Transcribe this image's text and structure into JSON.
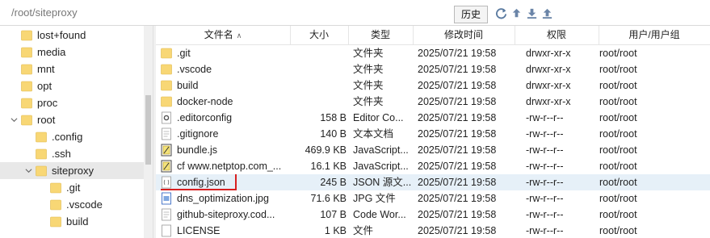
{
  "pathbar": {
    "path": "/root/siteproxy",
    "history_label": "历史",
    "icons": [
      "refresh-icon",
      "up-arrow-icon",
      "download-icon",
      "upload-icon"
    ]
  },
  "tree": {
    "items": [
      {
        "label": "lost+found",
        "indent": 0,
        "expander": ""
      },
      {
        "label": "media",
        "indent": 0,
        "expander": ""
      },
      {
        "label": "mnt",
        "indent": 0,
        "expander": ""
      },
      {
        "label": "opt",
        "indent": 0,
        "expander": ""
      },
      {
        "label": "proc",
        "indent": 0,
        "expander": ""
      },
      {
        "label": "root",
        "indent": 0,
        "expander": "expanded"
      },
      {
        "label": ".config",
        "indent": 1,
        "expander": ""
      },
      {
        "label": ".ssh",
        "indent": 1,
        "expander": ""
      },
      {
        "label": "siteproxy",
        "indent": 1,
        "expander": "expanded",
        "selected": true
      },
      {
        "label": ".git",
        "indent": 2,
        "expander": ""
      },
      {
        "label": ".vscode",
        "indent": 2,
        "expander": ""
      },
      {
        "label": "build",
        "indent": 2,
        "expander": ""
      }
    ]
  },
  "list": {
    "columns": {
      "name": "文件名",
      "size": "大小",
      "type": "类型",
      "date": "修改时间",
      "perm": "权限",
      "owner": "用户/用户组"
    },
    "rows": [
      {
        "name": ".git",
        "size": "",
        "type": "文件夹",
        "date": "2025/07/21 19:58",
        "perm": "drwxr-xr-x",
        "owner": "root/root",
        "icon": "folder-icon"
      },
      {
        "name": ".vscode",
        "size": "",
        "type": "文件夹",
        "date": "2025/07/21 19:58",
        "perm": "drwxr-xr-x",
        "owner": "root/root",
        "icon": "folder-icon"
      },
      {
        "name": "build",
        "size": "",
        "type": "文件夹",
        "date": "2025/07/21 19:58",
        "perm": "drwxr-xr-x",
        "owner": "root/root",
        "icon": "folder-icon"
      },
      {
        "name": "docker-node",
        "size": "",
        "type": "文件夹",
        "date": "2025/07/21 19:58",
        "perm": "drwxr-xr-x",
        "owner": "root/root",
        "icon": "folder-icon"
      },
      {
        "name": ".editorconfig",
        "size": "158 B",
        "type": "Editor Co...",
        "date": "2025/07/21 19:58",
        "perm": "-rw-r--r--",
        "owner": "root/root",
        "icon": "gear-file-icon"
      },
      {
        "name": ".gitignore",
        "size": "140 B",
        "type": "文本文档",
        "date": "2025/07/21 19:58",
        "perm": "-rw-r--r--",
        "owner": "root/root",
        "icon": "text-file-icon"
      },
      {
        "name": "bundle.js",
        "size": "469.9 KB",
        "type": "JavaScript...",
        "date": "2025/07/21 19:58",
        "perm": "-rw-r--r--",
        "owner": "root/root",
        "icon": "script-file-icon"
      },
      {
        "name": "cf www.netptop.com_...",
        "size": "16.1 KB",
        "type": "JavaScript...",
        "date": "2025/07/21 19:58",
        "perm": "-rw-r--r--",
        "owner": "root/root",
        "icon": "script-file-icon"
      },
      {
        "name": "config.json",
        "size": "245 B",
        "type": "JSON 源文...",
        "date": "2025/07/21 19:58",
        "perm": "-rw-r--r--",
        "owner": "root/root",
        "icon": "json-file-icon",
        "highlight": true
      },
      {
        "name": "dns_optimization.jpg",
        "size": "71.6 KB",
        "type": "JPG 文件",
        "date": "2025/07/21 19:58",
        "perm": "-rw-r--r--",
        "owner": "root/root",
        "icon": "image-file-icon"
      },
      {
        "name": "github-siteproxy.cod...",
        "size": "107 B",
        "type": "Code Wor...",
        "date": "2025/07/21 19:58",
        "perm": "-rw-r--r--",
        "owner": "root/root",
        "icon": "text-file-icon"
      },
      {
        "name": "LICENSE",
        "size": "1 KB",
        "type": "文件",
        "date": "2025/07/21 19:58",
        "perm": "-rw-r--r--",
        "owner": "root/root",
        "icon": "blank-file-icon"
      }
    ]
  },
  "colors": {
    "folder": "#f8d775",
    "folder_edge": "#e0b84a",
    "selection": "#e6f0f8",
    "annotation": "#d82020"
  }
}
